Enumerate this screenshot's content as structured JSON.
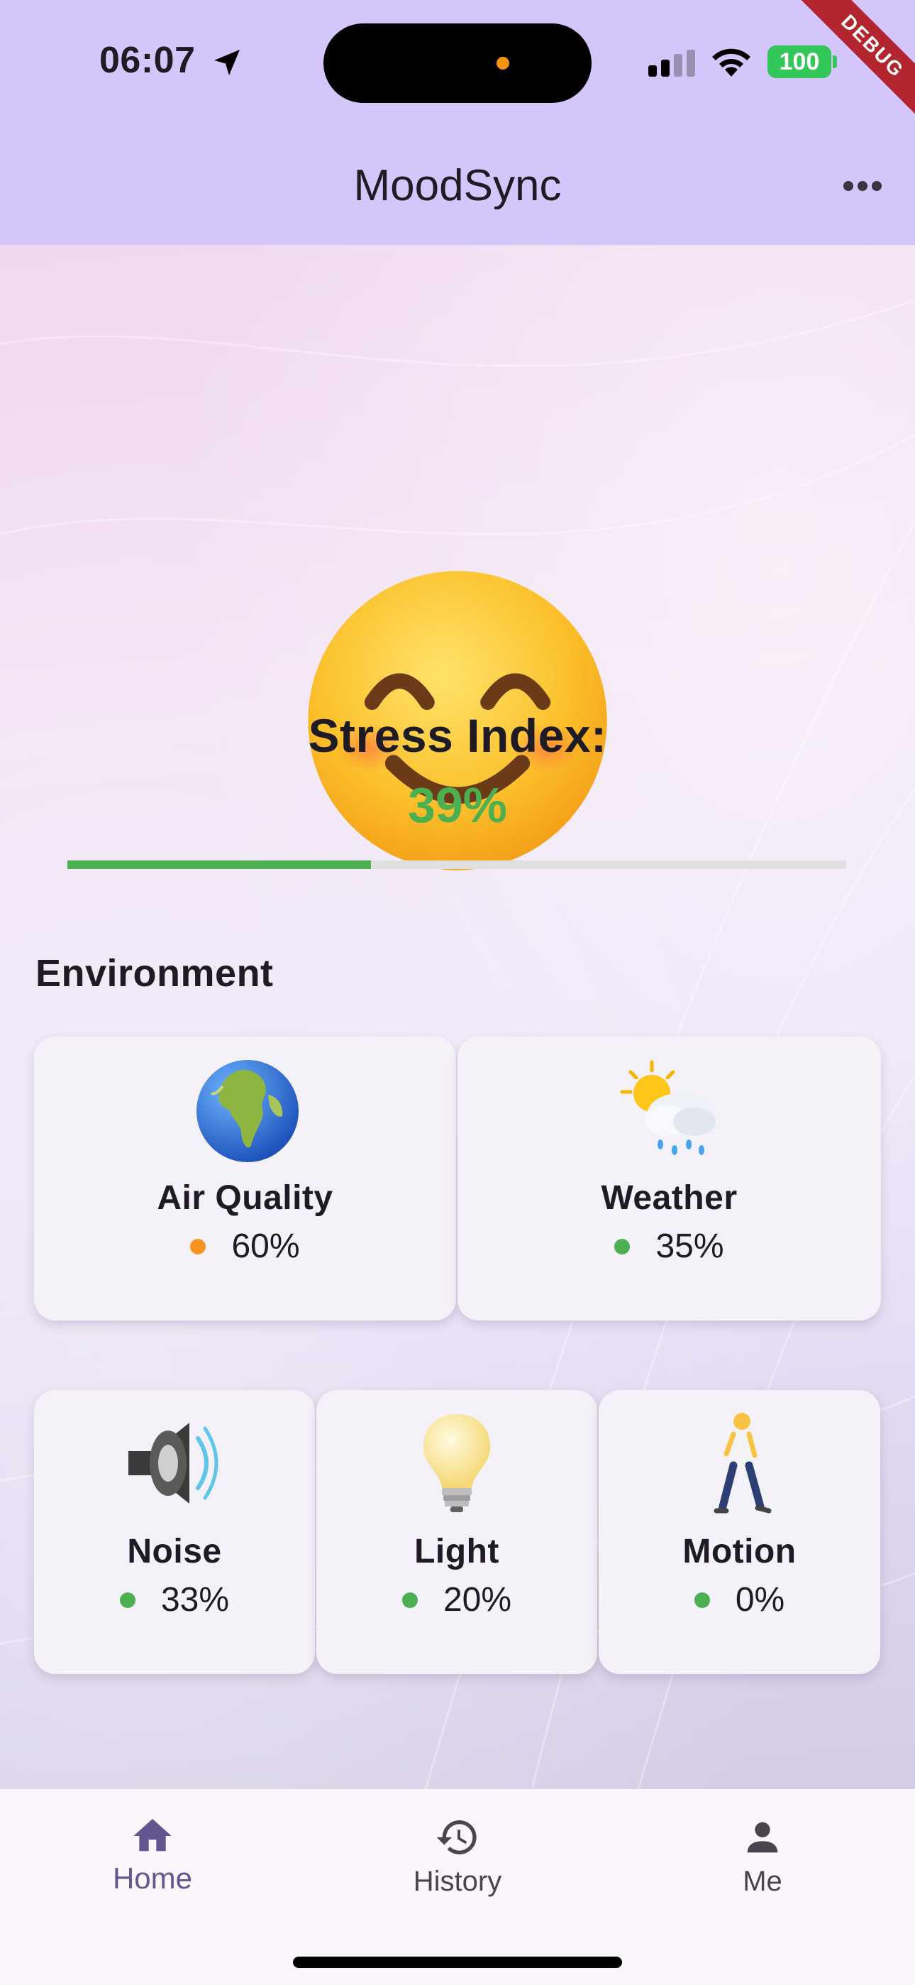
{
  "status_bar": {
    "time": "06:07",
    "battery": "100",
    "debug_banner": "DEBUG"
  },
  "app_bar": {
    "title": "MoodSync",
    "menu_icon": "more-horizontal-icon"
  },
  "mood": {
    "emoji": "smiling-face-icon",
    "stress_label": "Stress Index:",
    "stress_value_text": "39%",
    "stress_value": 0.39,
    "stress_color": "#4caf50"
  },
  "environment": {
    "title": "Environment",
    "cards": [
      {
        "label": "Air Quality",
        "value": "60%",
        "status_color": "#f7931e",
        "icon": "globe-icon"
      },
      {
        "label": "Weather",
        "value": "35%",
        "status_color": "#4caf50",
        "icon": "sun-behind-rain-cloud-icon"
      },
      {
        "label": "Noise",
        "value": "33%",
        "status_color": "#4caf50",
        "icon": "speaker-icon"
      },
      {
        "label": "Light",
        "value": "20%",
        "status_color": "#4caf50",
        "icon": "light-bulb-icon"
      },
      {
        "label": "Motion",
        "value": "0%",
        "status_color": "#4caf50",
        "icon": "person-walking-icon"
      }
    ]
  },
  "bottom_nav": {
    "items": [
      {
        "label": "Home",
        "icon": "home-icon",
        "active": true
      },
      {
        "label": "History",
        "icon": "history-icon",
        "active": false
      },
      {
        "label": "Me",
        "icon": "person-icon",
        "active": false
      }
    ],
    "active_color": "#65558f",
    "inactive_color": "#49454f"
  }
}
